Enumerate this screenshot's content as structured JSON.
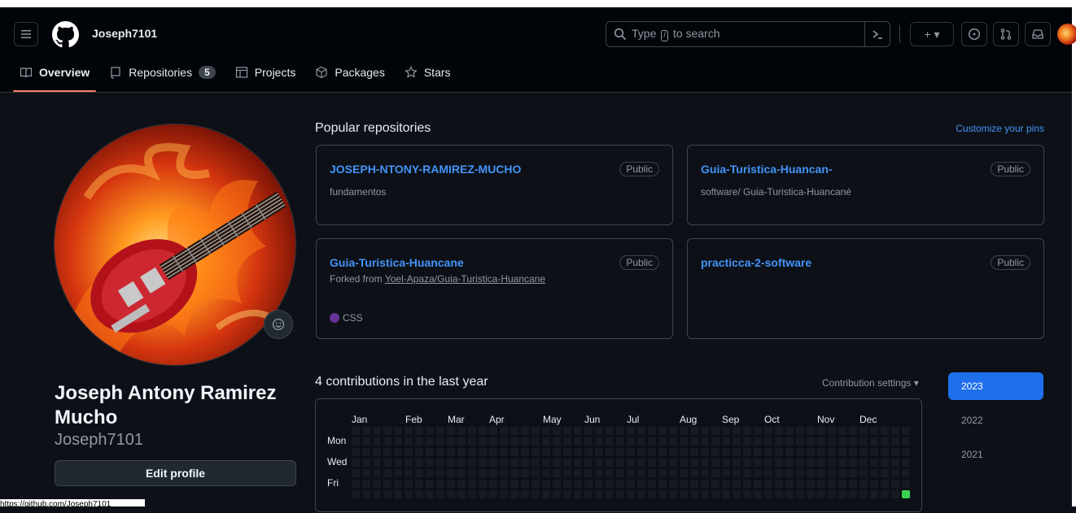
{
  "header": {
    "username": "Joseph7101",
    "search_prefix": "Type",
    "search_key": "/",
    "search_suffix": "to search",
    "plus_caret": "+ ▾"
  },
  "tabs": [
    {
      "label": "Overview",
      "icon": "book-icon",
      "active": true
    },
    {
      "label": "Repositories",
      "icon": "repo-icon",
      "count": "5"
    },
    {
      "label": "Projects",
      "icon": "table-icon"
    },
    {
      "label": "Packages",
      "icon": "package-icon"
    },
    {
      "label": "Stars",
      "icon": "star-icon"
    }
  ],
  "profile": {
    "full_name": "Joseph Antony Ramirez Mucho",
    "login": "Joseph7101",
    "edit_label": "Edit profile"
  },
  "status_url": "https://github.com/Joseph7101",
  "popular": {
    "title": "Popular repositories",
    "customize": "Customize your pins",
    "repos": [
      {
        "name": "JOSEPH-NTONY-RAMIREZ-MUCHO",
        "badge": "Public",
        "desc": "fundamentos"
      },
      {
        "name": "Guia-Turistica-Huancan-",
        "badge": "Public",
        "desc": "software/ Guia-Turistica-Huancané"
      },
      {
        "name": "Guia-Turistica-Huancane",
        "badge": "Public",
        "forked_prefix": "Forked from",
        "forked_repo": "Yoel-Apaza/Guia-Turistica-Huancane",
        "language": "CSS",
        "language_color": "#663399"
      },
      {
        "name": "practicca-2-software",
        "badge": "Public"
      }
    ]
  },
  "contributions": {
    "title": "4 contributions in the last year",
    "settings": "Contribution settings ▾",
    "months": [
      "Jan",
      "Feb",
      "Mar",
      "Apr",
      "May",
      "Jun",
      "Jul",
      "Aug",
      "Sep",
      "Oct",
      "Nov",
      "Dec"
    ],
    "days": [
      "Mon",
      "Wed",
      "Fri"
    ],
    "years": [
      {
        "label": "2023",
        "active": true
      },
      {
        "label": "2022"
      },
      {
        "label": "2021"
      }
    ],
    "empty_color": "#161b22",
    "filled_color": "#39d353"
  },
  "colors": {
    "bg": "#0d1117",
    "header_bg": "#010409",
    "link": "#4493f8",
    "border": "#3d444d",
    "tab_underline": "#f78166",
    "year_active": "#1f6feb"
  }
}
